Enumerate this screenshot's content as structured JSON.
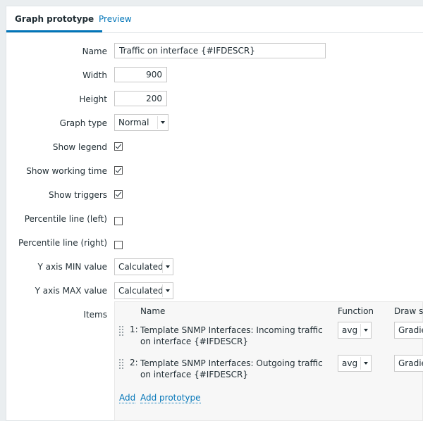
{
  "tabs": [
    {
      "label": "Graph prototype",
      "active": true
    },
    {
      "label": "Preview",
      "active": false
    }
  ],
  "form": {
    "name": {
      "label": "Name",
      "value": "Traffic on interface {#IFDESCR}"
    },
    "width": {
      "label": "Width",
      "value": "900"
    },
    "height": {
      "label": "Height",
      "value": "200"
    },
    "graph_type": {
      "label": "Graph type",
      "value": "Normal"
    },
    "show_legend": {
      "label": "Show legend",
      "checked": true
    },
    "show_working_time": {
      "label": "Show working time",
      "checked": true
    },
    "show_triggers": {
      "label": "Show triggers",
      "checked": true
    },
    "percentile_left": {
      "label": "Percentile line (left)",
      "checked": false
    },
    "percentile_right": {
      "label": "Percentile line (right)",
      "checked": false
    },
    "y_min": {
      "label": "Y axis MIN value",
      "value": "Calculated"
    },
    "y_max": {
      "label": "Y axis MAX value",
      "value": "Calculated"
    }
  },
  "items": {
    "label": "Items",
    "headers": {
      "name": "Name",
      "function": "Function",
      "draw_style": "Draw st"
    },
    "rows": [
      {
        "num": "1:",
        "name": "Template SNMP Interfaces: Incoming traffic on interface {#IFDESCR}",
        "function": "avg",
        "draw_style": "Gradie"
      },
      {
        "num": "2:",
        "name": "Template SNMP Interfaces: Outgoing traffic on interface {#IFDESCR}",
        "function": "avg",
        "draw_style": "Gradie"
      }
    ],
    "add_label": "Add",
    "add_prototype_label": "Add prototype"
  },
  "colors": {
    "accent": "#0275b8",
    "background": "#eaeef0",
    "panel": "#ffffff"
  }
}
